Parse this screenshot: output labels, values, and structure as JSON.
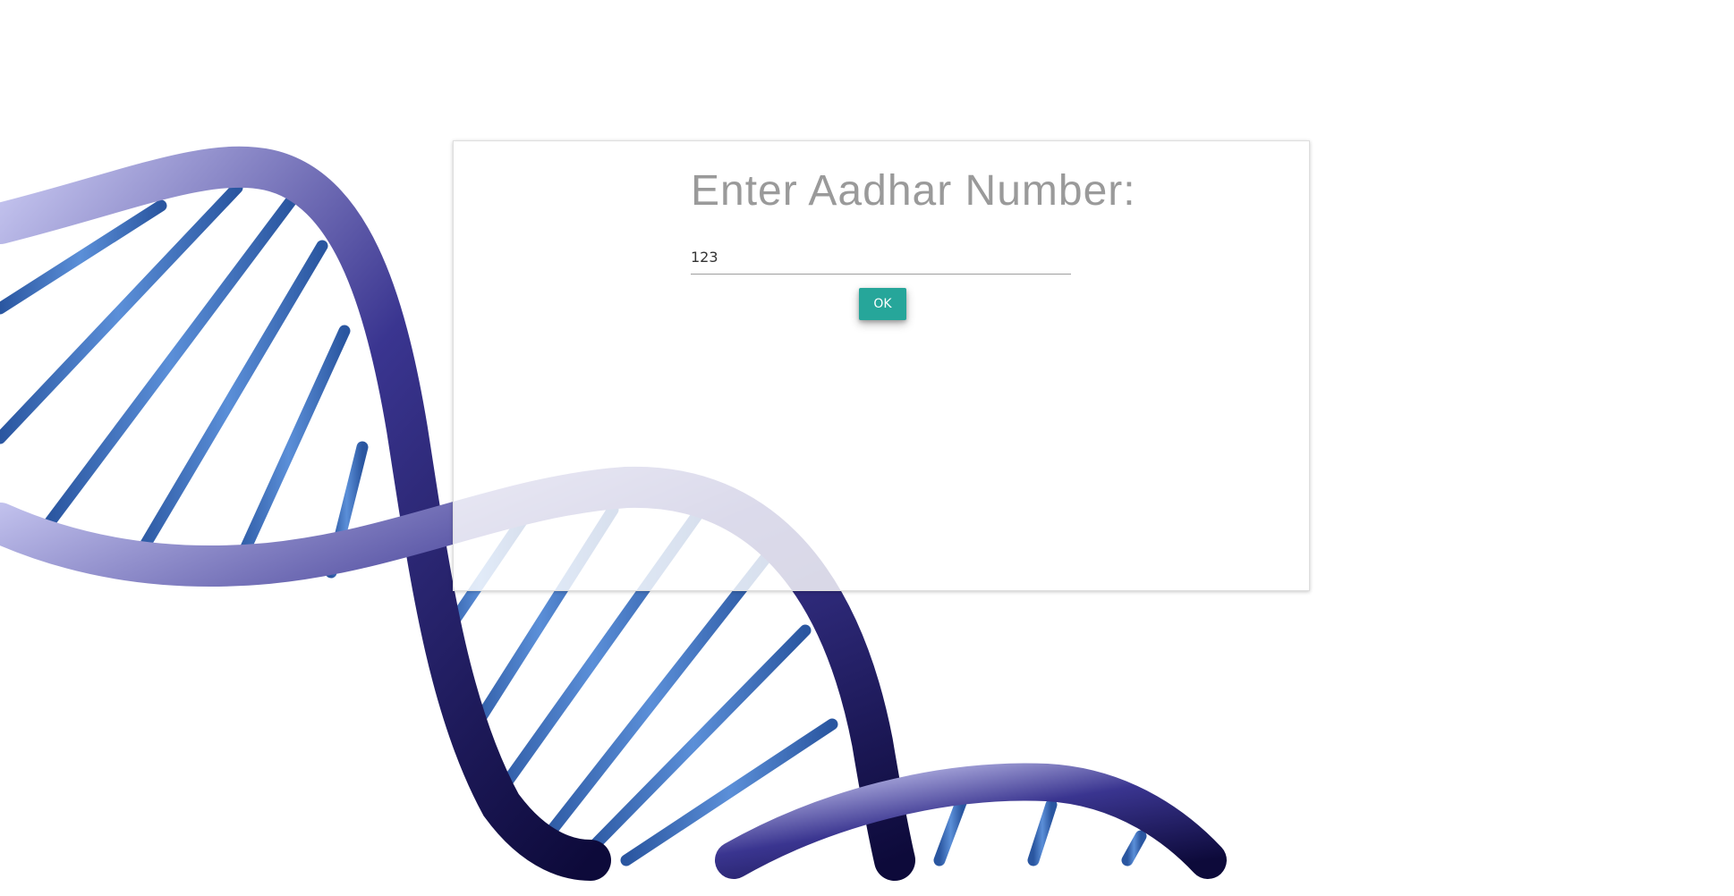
{
  "form": {
    "title": "Enter Aadhar Number:",
    "aadhar_value": "123",
    "ok_label": "OK"
  },
  "colors": {
    "accent": "#26a69a",
    "helix_dark": "#1a1650",
    "helix_light": "#b8b8ee",
    "rung": "#3f6fb8"
  },
  "background": {
    "image": "dna-double-helix"
  }
}
